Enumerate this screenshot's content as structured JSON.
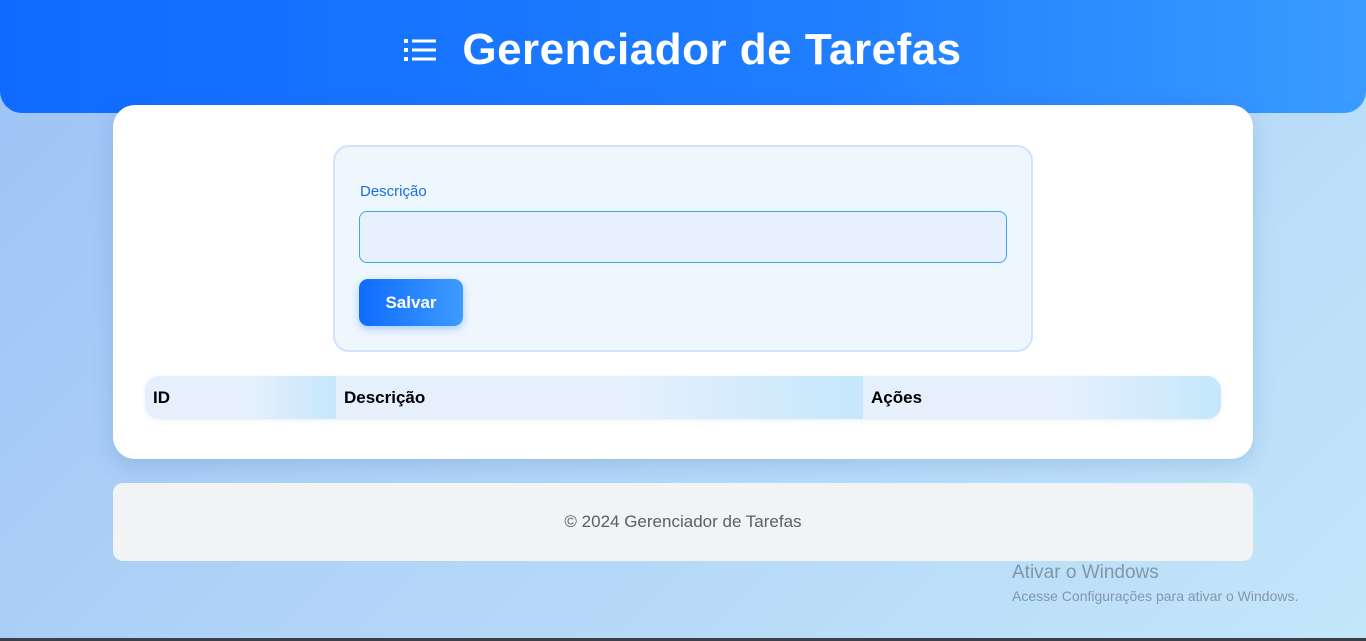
{
  "header": {
    "title": "Gerenciador de Tarefas",
    "icon": "list-icon"
  },
  "form": {
    "description_label": "Descrição",
    "description_value": "",
    "save_label": "Salvar"
  },
  "table": {
    "columns": [
      "ID",
      "Descrição",
      "Ações"
    ],
    "rows": []
  },
  "footer": {
    "text": "© 2024 Gerenciador de Tarefas"
  },
  "watermark": {
    "title": "Ativar o Windows",
    "subtitle": "Acesse Configurações para ativar o Windows."
  },
  "colors": {
    "primary": "#0f6bff",
    "label": "#1a6fe0",
    "input_border": "#43a4e4"
  }
}
